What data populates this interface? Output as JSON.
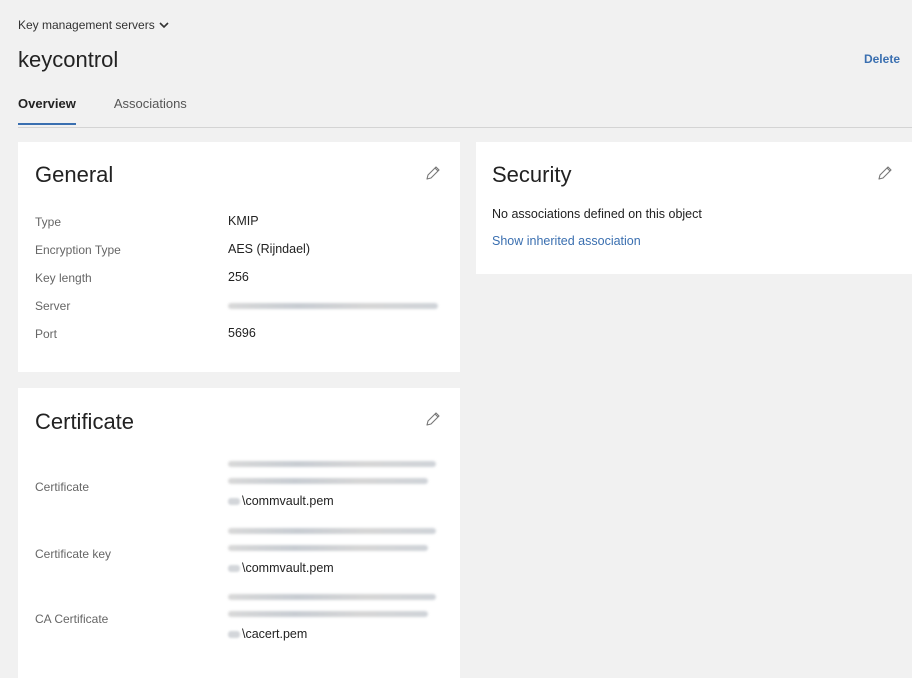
{
  "header": {
    "breadcrumb": "Key management servers",
    "title": "keycontrol",
    "delete_label": "Delete"
  },
  "tabs": [
    {
      "label": "Overview",
      "active": true
    },
    {
      "label": "Associations",
      "active": false
    }
  ],
  "general": {
    "title": "General",
    "rows": [
      {
        "label": "Type",
        "value": "KMIP"
      },
      {
        "label": "Encryption Type",
        "value": "AES (Rijndael)"
      },
      {
        "label": "Key length",
        "value": "256"
      },
      {
        "label": "Server",
        "value": ""
      },
      {
        "label": "Port",
        "value": "5696"
      }
    ]
  },
  "certificate": {
    "title": "Certificate",
    "rows": [
      {
        "label": "Certificate",
        "file": "\\commvault.pem"
      },
      {
        "label": "Certificate key",
        "file": "\\commvault.pem"
      },
      {
        "label": "CA Certificate",
        "file": "\\cacert.pem"
      }
    ]
  },
  "security": {
    "title": "Security",
    "message": "No associations defined on this object",
    "link": "Show inherited association"
  },
  "colors": {
    "accent": "#3a6fb0",
    "background": "#f1f1f1"
  },
  "icons": {
    "edit": "pencil-icon",
    "dropdown": "chevron-down-icon"
  }
}
